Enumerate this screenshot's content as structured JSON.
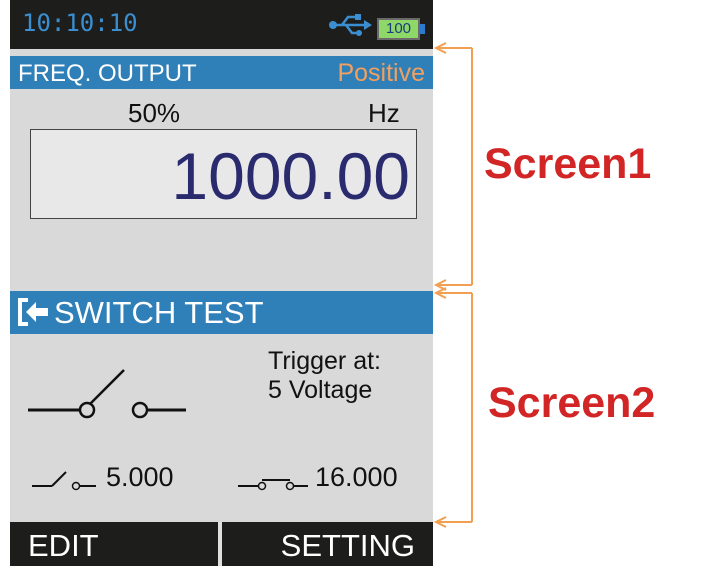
{
  "status_bar": {
    "time": "10:10:10",
    "battery_level": "100",
    "usb_icon": "usb-icon"
  },
  "freq_output": {
    "title": "FREQ. OUTPUT",
    "mode": "Positive",
    "duty_cycle": "50%",
    "unit": "Hz",
    "value": "1000.00"
  },
  "switch_test": {
    "title": "SWITCH TEST",
    "icon": "exit-icon",
    "trigger_line1": "Trigger at:",
    "trigger_line2": "5 Voltage",
    "open_value": "5.000",
    "closed_value": "16.000"
  },
  "softkeys": {
    "left": "EDIT",
    "right": "SETTING"
  },
  "annotations": {
    "screen1": "Screen1",
    "screen2": "Screen2"
  },
  "colors": {
    "header_blue": "#2f7fb8",
    "mode_orange": "#f0a060",
    "annotation_red": "#d22525",
    "bracket_orange": "#f0a050",
    "value_navy": "#2a2a6e",
    "time_blue": "#3b8fd0",
    "battery_green": "#8ed86a"
  }
}
